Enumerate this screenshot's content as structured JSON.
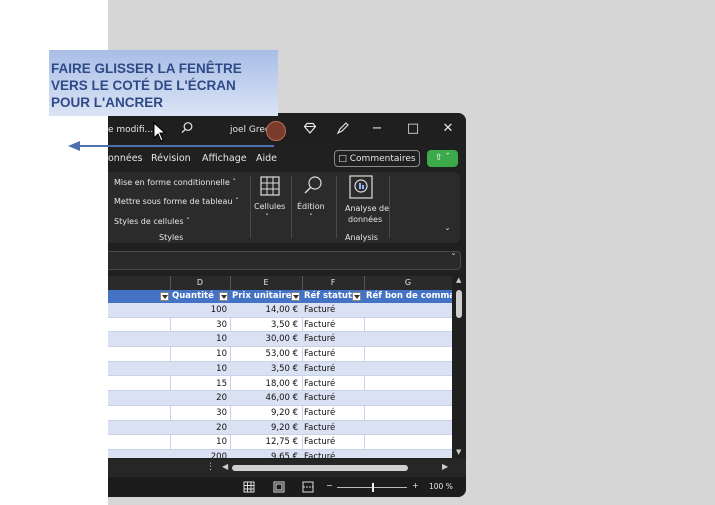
{
  "window": {
    "title_fragment": "e modifi...",
    "user_name": "joel Green",
    "minimize_glyph": "−",
    "maximize_glyph": "□",
    "close_glyph": "✕"
  },
  "tabs": [
    "onnées",
    "Révision",
    "Affichage",
    "Aide"
  ],
  "comments_label": "Commentaires",
  "ribbon": {
    "styles_items": [
      "Mise en forme conditionnelle ˇ",
      "Mettre sous forme de tableau ˇ",
      "Styles de cellules ˇ"
    ],
    "styles_group": "Styles",
    "cells_label": "Cellules",
    "edit_label": "Édition",
    "analysis_label_1": "Analyse de",
    "analysis_label_2": "données",
    "analysis_group": "Analysis"
  },
  "columns": [
    "D",
    "E",
    "F",
    "G"
  ],
  "table_headers": [
    "Quantité",
    "Prix unitaire",
    "Réf statut",
    "Réf bon de comma"
  ],
  "rows": [
    {
      "qty": "100",
      "price": "14,00 €",
      "status": "Facturé"
    },
    {
      "qty": "30",
      "price": "3,50 €",
      "status": "Facturé"
    },
    {
      "qty": "10",
      "price": "30,00 €",
      "status": "Facturé"
    },
    {
      "qty": "10",
      "price": "53,00 €",
      "status": "Facturé"
    },
    {
      "qty": "10",
      "price": "3,50 €",
      "status": "Facturé"
    },
    {
      "qty": "15",
      "price": "18,00 €",
      "status": "Facturé"
    },
    {
      "qty": "20",
      "price": "46,00 €",
      "status": "Facturé"
    },
    {
      "qty": "30",
      "price": "9,20 €",
      "status": "Facturé"
    },
    {
      "qty": "20",
      "price": "9,20 €",
      "status": "Facturé"
    },
    {
      "qty": "10",
      "price": "12,75 €",
      "status": "Facturé"
    },
    {
      "qty": "200",
      "price": "9,65 €",
      "status": "Facturé"
    }
  ],
  "status": {
    "zoom": "100 %"
  },
  "callout_text": "FAIRE GLISSER LA FENÊTRE\nVERS LE COTÉ DE L'ÉCRAN\nPOUR L'ANCRER",
  "colors": {
    "table_header": "#4472c4",
    "banded_row": "#d9e1f2",
    "share_green": "#3ca94a",
    "callout_text": "#2f4a87"
  }
}
